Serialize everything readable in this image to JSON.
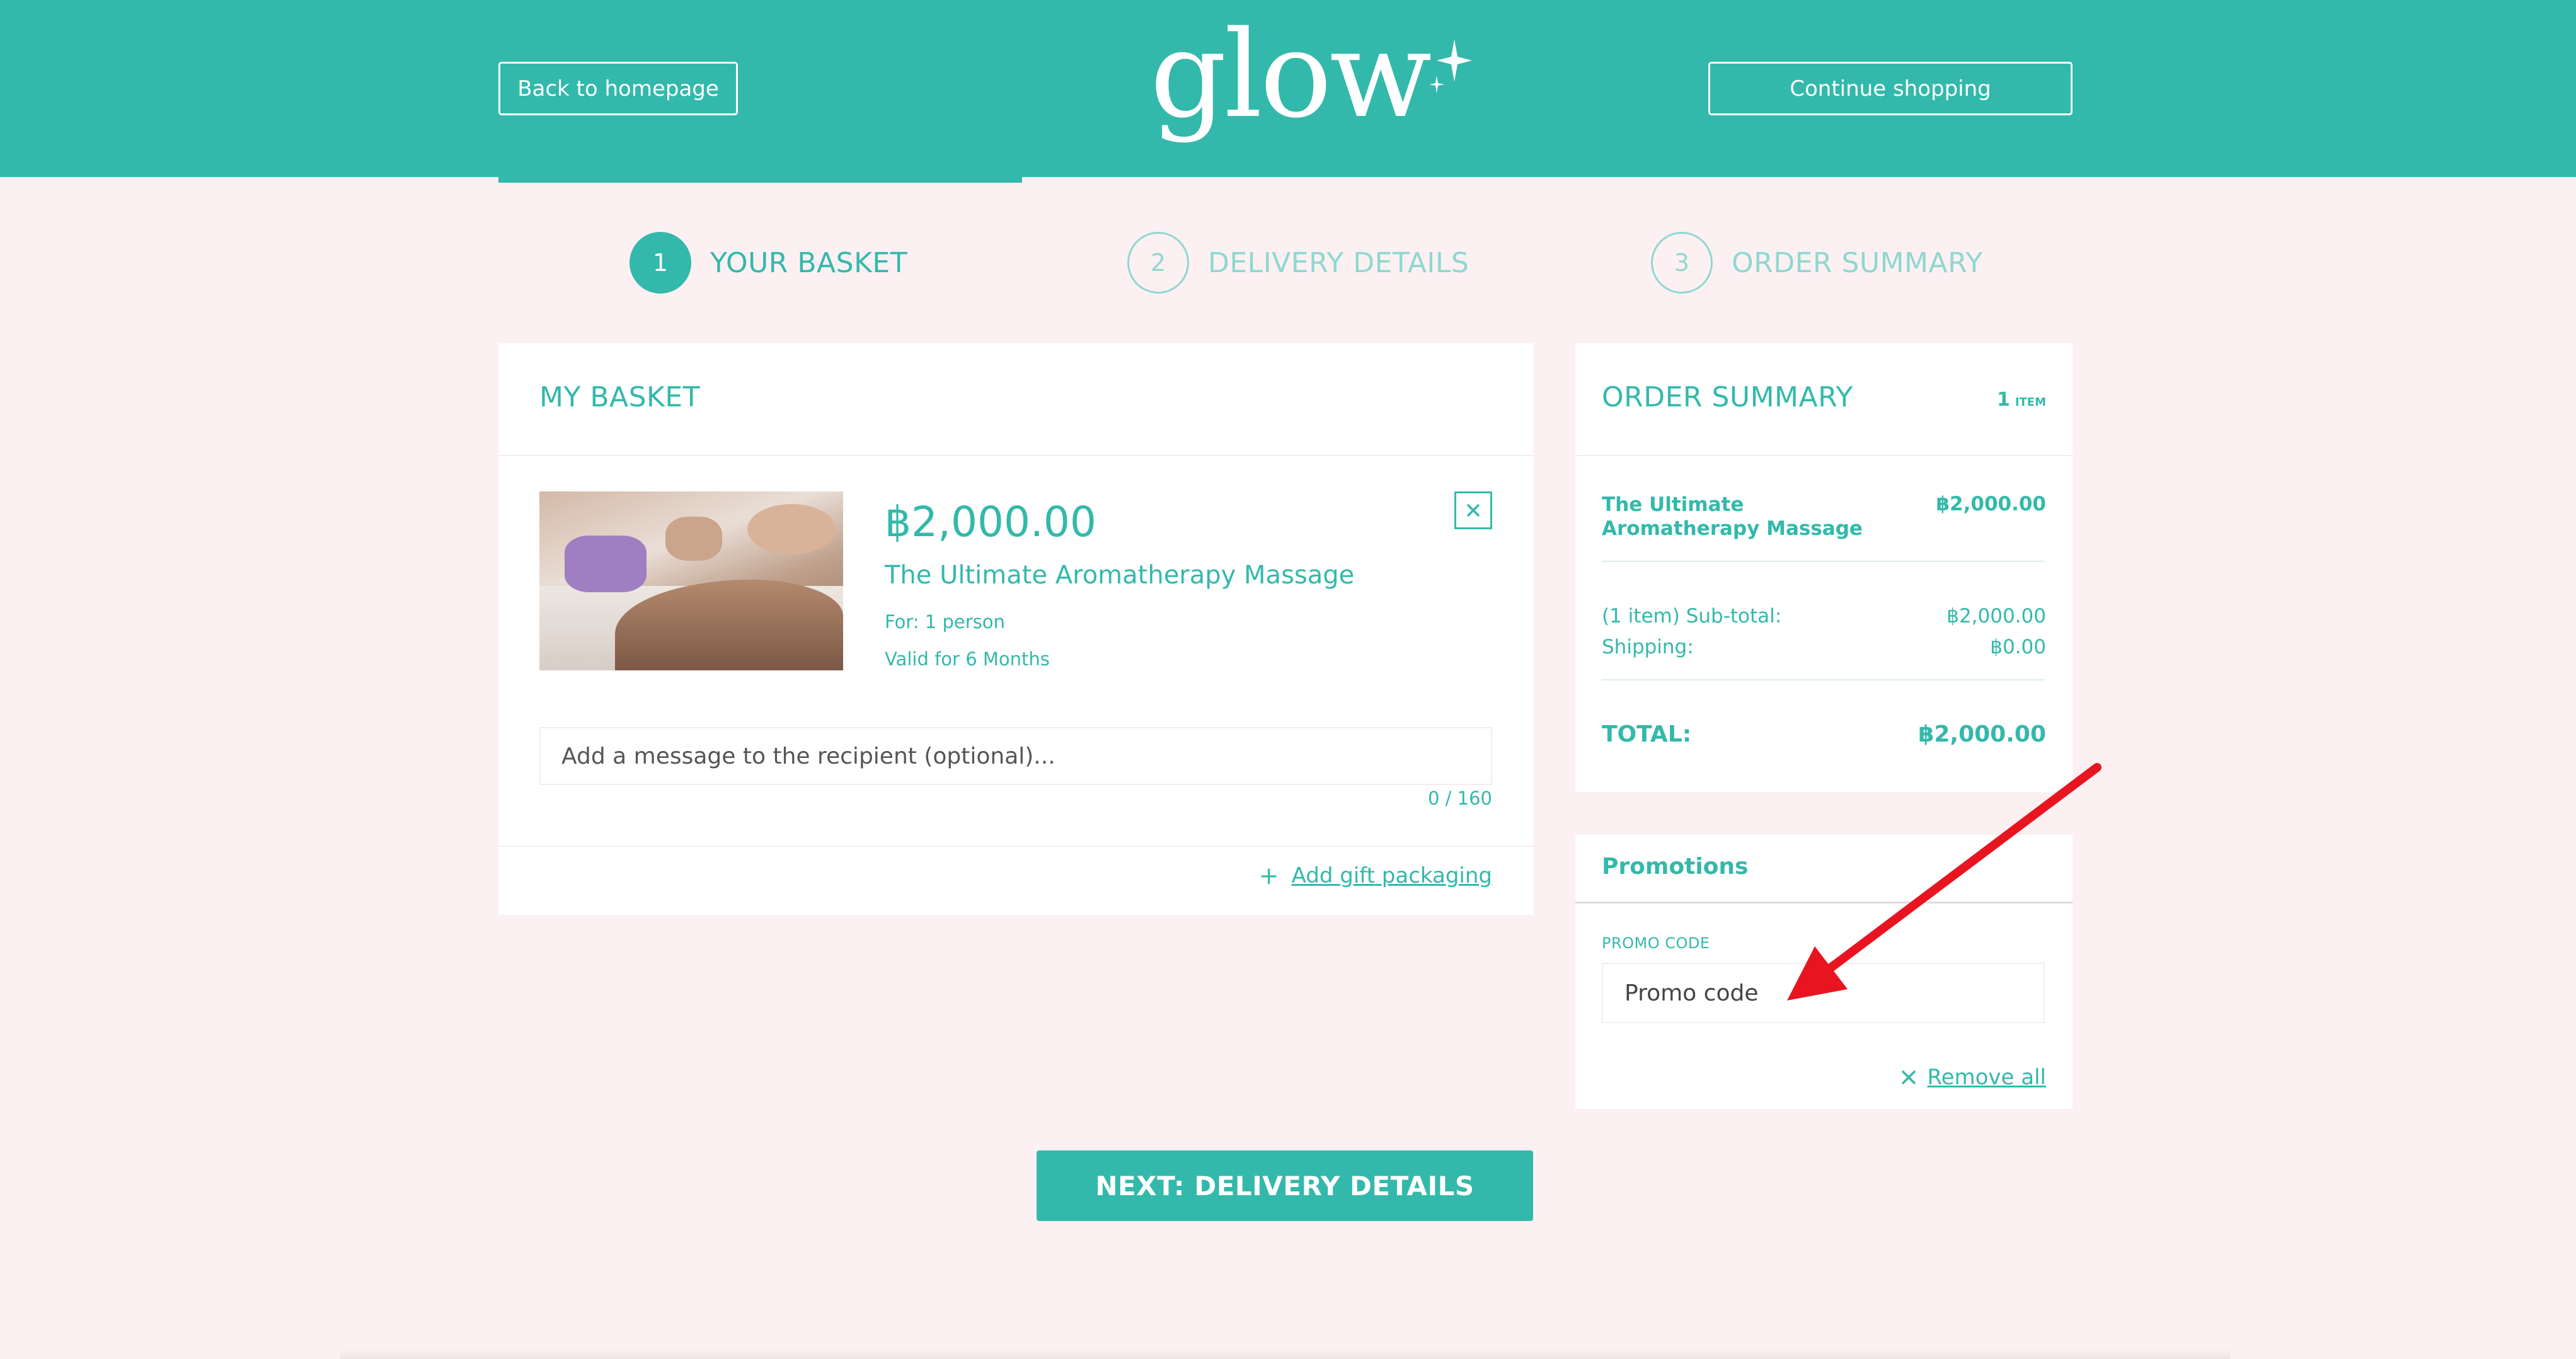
{
  "header": {
    "back_label": "Back to homepage",
    "continue_label": "Continue shopping",
    "logo_text": "glow"
  },
  "steps": [
    {
      "number": "1",
      "label": "YOUR BASKET",
      "active": true
    },
    {
      "number": "2",
      "label": "DELIVERY DETAILS",
      "active": false
    },
    {
      "number": "3",
      "label": "ORDER SUMMARY",
      "active": false
    }
  ],
  "basket": {
    "title": "MY BASKET",
    "item": {
      "price": "฿2,000.00",
      "name": "The Ultimate Aromatherapy Massage",
      "for": "For: 1 person",
      "validity": "Valid for 6 Months"
    },
    "message_placeholder": "Add a message to the recipient (optional)...",
    "char_count": "0 / 160",
    "gift_packaging_label": "Add gift packaging"
  },
  "summary": {
    "title": "ORDER SUMMARY",
    "count": "1",
    "count_unit": "ITEM",
    "item_name": "The Ultimate Aromatherapy Massage",
    "item_price": "฿2,000.00",
    "subtotal_label": "(1 item) Sub-total:",
    "subtotal_value": "฿2,000.00",
    "shipping_label": "Shipping:",
    "shipping_value": "฿0.00",
    "total_label": "TOTAL:",
    "total_value": "฿2,000.00"
  },
  "promotions": {
    "title": "Promotions",
    "code_label": "PROMO CODE",
    "code_placeholder": "Promo code",
    "remove_all_label": "Remove all"
  },
  "next_button_label": "NEXT: DELIVERY DETAILS",
  "colors": {
    "brand": "#33b9ab",
    "page_background": "#fcf0f3",
    "annotation": "#e8141f"
  }
}
